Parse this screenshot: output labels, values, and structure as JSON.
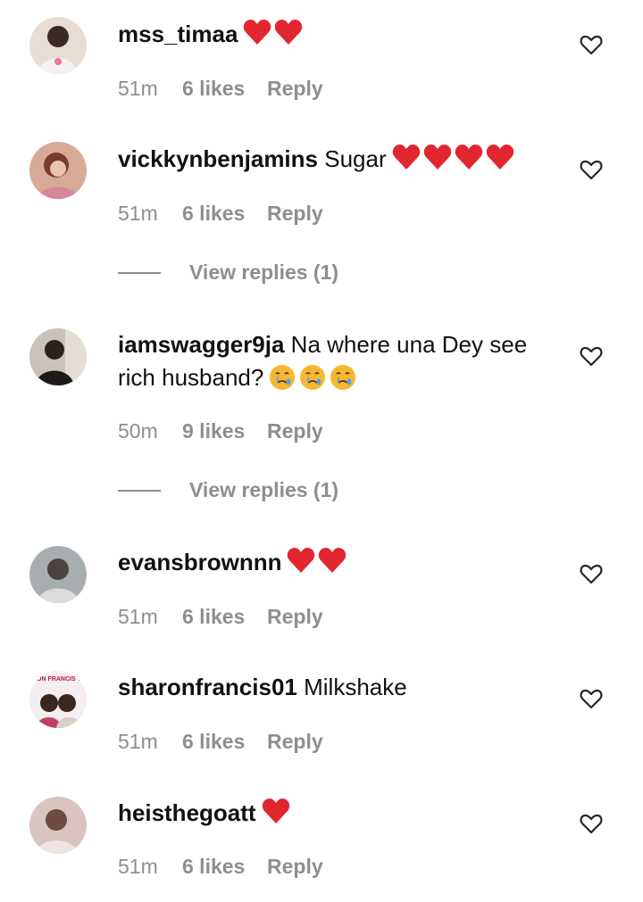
{
  "comments": [
    {
      "username": "mss_timaa",
      "text": "",
      "hearts": 2,
      "time": "51m",
      "likes": "6 likes",
      "reply": "Reply",
      "avatar_color": "#d9c2b0"
    },
    {
      "username": "vickkynbenjamins",
      "text": "Sugar",
      "hearts": 4,
      "time": "51m",
      "likes": "6 likes",
      "reply": "Reply",
      "view_replies": "View replies (1)",
      "avatar_color": "#c98f78"
    },
    {
      "username": "iamswagger9ja",
      "text": "Na where una Dey see",
      "text2": "rich husband?",
      "emoji": "crying-face",
      "emoji_count": 3,
      "time": "50m",
      "likes": "9 likes",
      "reply": "Reply",
      "view_replies": "View replies (1)",
      "avatar_color": "#5a4a3d"
    },
    {
      "username": "evansbrownnn",
      "text": "",
      "hearts": 2,
      "time": "51m",
      "likes": "6 likes",
      "reply": "Reply",
      "avatar_color": "#8a9090"
    },
    {
      "username": "sharonfrancis01",
      "text": "Milkshake",
      "time": "51m",
      "likes": "6 likes",
      "reply": "Reply",
      "avatar_color": "#c06a86",
      "avatar_text": "RON FRANCIS T"
    },
    {
      "username": "heisthegoatt",
      "text": "",
      "hearts": 1,
      "time": "51m",
      "likes": "6 likes",
      "reply": "Reply",
      "avatar_color": "#b59a94"
    }
  ],
  "colors": {
    "heart": "#e2262f",
    "meta": "#8e8e8e",
    "text": "#111111"
  },
  "icons": {
    "like": "heart-outline-icon",
    "heart_emoji": "red-heart-icon"
  }
}
